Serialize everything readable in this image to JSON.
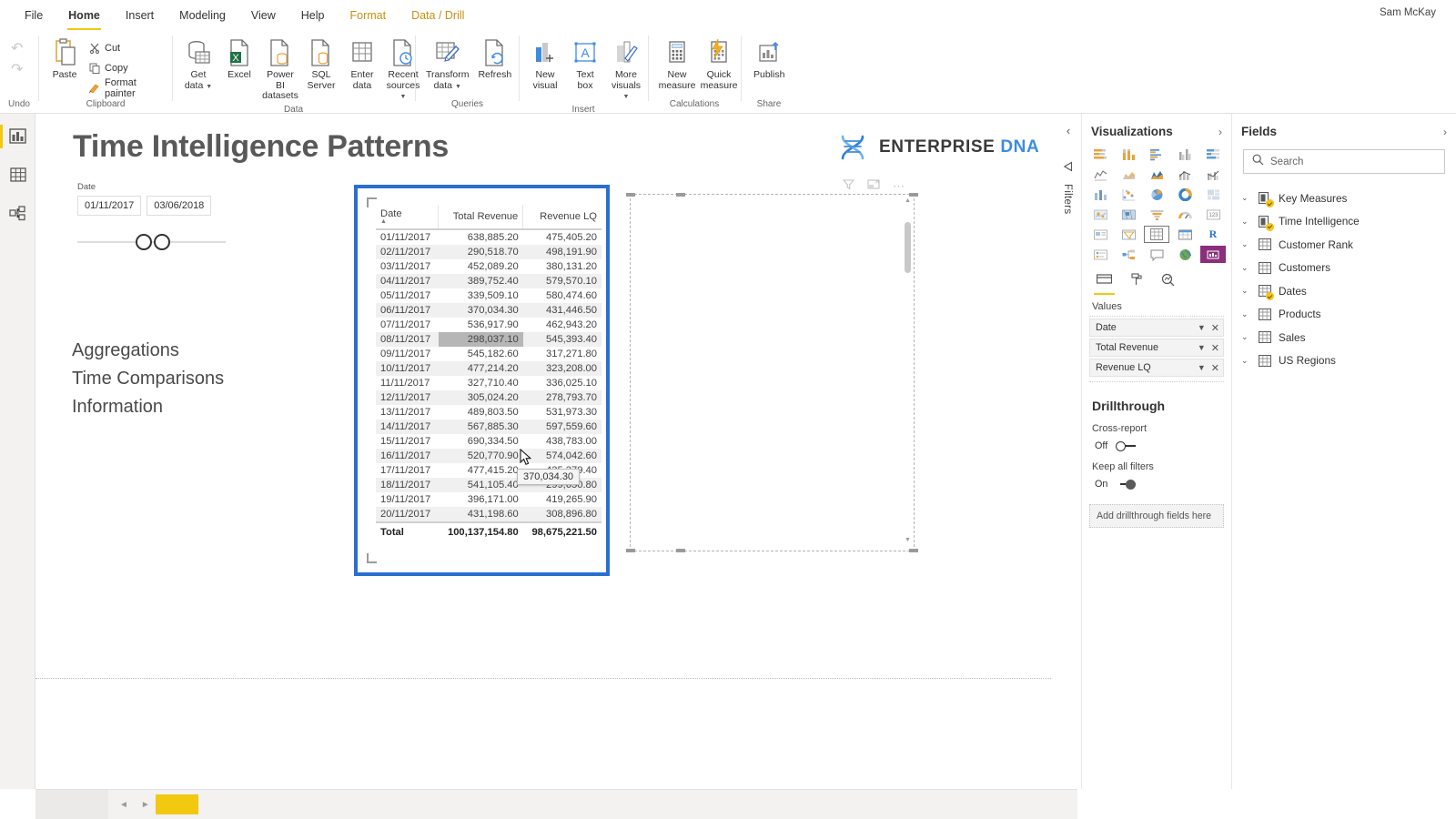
{
  "window": {
    "user": "Sam McKay"
  },
  "menu": {
    "items": [
      {
        "label": "File",
        "state": "normal"
      },
      {
        "label": "Home",
        "state": "active"
      },
      {
        "label": "Insert",
        "state": "normal"
      },
      {
        "label": "Modeling",
        "state": "normal"
      },
      {
        "label": "View",
        "state": "normal"
      },
      {
        "label": "Help",
        "state": "normal"
      },
      {
        "label": "Format",
        "state": "amber"
      },
      {
        "label": "Data / Drill",
        "state": "amber"
      }
    ]
  },
  "ribbon": {
    "groups": [
      {
        "label": "Undo"
      },
      {
        "label": "Clipboard"
      },
      {
        "label": "Data"
      },
      {
        "label": "Queries"
      },
      {
        "label": "Insert"
      },
      {
        "label": "Calculations"
      },
      {
        "label": "Share"
      }
    ],
    "clipboard": {
      "paste": "Paste",
      "cut": "Cut",
      "copy": "Copy",
      "format_painter": "Format painter"
    },
    "data": {
      "get_data_l1": "Get",
      "get_data_l2": "data",
      "excel_l1": "Excel",
      "excel_l2": "",
      "powerbi_l1": "Power BI",
      "powerbi_l2": "datasets",
      "sql_l1": "SQL",
      "sql_l2": "Server",
      "enter_l1": "Enter",
      "enter_l2": "data",
      "recent_l1": "Recent",
      "recent_l2": "sources"
    },
    "queries": {
      "transform_l1": "Transform",
      "transform_l2": "data",
      "refresh_l1": "Refresh",
      "refresh_l2": ""
    },
    "insert": {
      "new_visual_l1": "New",
      "new_visual_l2": "visual",
      "text_box_l1": "Text",
      "text_box_l2": "box",
      "more_visuals_l1": "More",
      "more_visuals_l2": "visuals"
    },
    "calculations": {
      "new_measure_l1": "New",
      "new_measure_l2": "measure",
      "quick_measure_l1": "Quick",
      "quick_measure_l2": "measure"
    },
    "share": {
      "publish_l1": "Publish",
      "publish_l2": ""
    }
  },
  "left_rail": {
    "items": [
      {
        "name": "report-view",
        "selected": true
      },
      {
        "name": "data-view",
        "selected": false
      },
      {
        "name": "model-view",
        "selected": false
      }
    ]
  },
  "report": {
    "title": "Time Intelligence Patterns",
    "logo": {
      "primary": "ENTERPRISE",
      "secondary": "DNA"
    },
    "slicer": {
      "label": "Date",
      "start": "01/11/2017",
      "end": "03/06/2018"
    },
    "text_block": {
      "line1": "Aggregations",
      "line2": "Time Comparisons",
      "line3": "Information"
    }
  },
  "table_visual": {
    "columns": [
      "Date",
      "Total Revenue",
      "Revenue LQ"
    ],
    "sort_column": "Date",
    "sort_direction": "asc",
    "rows": [
      [
        "01/11/2017",
        "638,885.20",
        "475,405.20"
      ],
      [
        "02/11/2017",
        "290,518.70",
        "498,191.90"
      ],
      [
        "03/11/2017",
        "452,089.20",
        "380,131.20"
      ],
      [
        "04/11/2017",
        "389,752.40",
        "579,570.10"
      ],
      [
        "05/11/2017",
        "339,509.10",
        "580,474.60"
      ],
      [
        "06/11/2017",
        "370,034.30",
        "431,446.50"
      ],
      [
        "07/11/2017",
        "536,917.90",
        "462,943.20"
      ],
      [
        "08/11/2017",
        "298,037.10",
        "545,393.40"
      ],
      [
        "09/11/2017",
        "545,182.60",
        "317,271.80"
      ],
      [
        "10/11/2017",
        "477,214.20",
        "323,208.00"
      ],
      [
        "11/11/2017",
        "327,710.40",
        "336,025.10"
      ],
      [
        "12/11/2017",
        "305,024.20",
        "278,793.70"
      ],
      [
        "13/11/2017",
        "489,803.50",
        "531,973.30"
      ],
      [
        "14/11/2017",
        "567,885.30",
        "597,559.60"
      ],
      [
        "15/11/2017",
        "690,334.50",
        "438,783.00"
      ],
      [
        "16/11/2017",
        "520,770.90",
        "574,042.60"
      ],
      [
        "17/11/2017",
        "477,415.20",
        "435,379.40"
      ],
      [
        "18/11/2017",
        "541,105.40",
        "299,650.80"
      ],
      [
        "19/11/2017",
        "396,171.00",
        "419,265.90"
      ],
      [
        "20/11/2017",
        "431,198.60",
        "308,896.80"
      ]
    ],
    "total_row": [
      "Total",
      "100,137,154.80",
      "98,675,221.50"
    ],
    "hovered_cell": {
      "row_index": 7,
      "column_index": 1
    },
    "tooltip": "370,034.30",
    "selection_color": "#2a6fd0"
  },
  "visualizations_pane": {
    "title": "Visualizations",
    "filters_label": "Filters",
    "selected_visual": "table",
    "format_tabs": [
      "fields-tab",
      "format-tab",
      "analytics-tab"
    ],
    "values_label": "Values",
    "wells": [
      {
        "name": "Date"
      },
      {
        "name": "Total Revenue"
      },
      {
        "name": "Revenue LQ"
      }
    ],
    "drillthrough": {
      "title": "Drillthrough",
      "cross_report_label": "Cross-report",
      "cross_report_value": "Off",
      "keep_filters_label": "Keep all filters",
      "keep_filters_value": "On",
      "drop_zone": "Add drillthrough fields here"
    }
  },
  "fields_pane": {
    "title": "Fields",
    "search_placeholder": "Search",
    "items": [
      {
        "label": "Key Measures",
        "type": "measure-table",
        "badge": true
      },
      {
        "label": "Time Intelligence",
        "type": "measure-table",
        "badge": true
      },
      {
        "label": "Customer Rank",
        "type": "table",
        "badge": false
      },
      {
        "label": "Customers",
        "type": "table",
        "badge": false
      },
      {
        "label": "Dates",
        "type": "table",
        "badge": true
      },
      {
        "label": "Products",
        "type": "table",
        "badge": false
      },
      {
        "label": "Sales",
        "type": "table",
        "badge": false
      },
      {
        "label": "US Regions",
        "type": "table",
        "badge": false
      }
    ]
  },
  "colors": {
    "accent_yellow": "#f2c811",
    "selection_blue": "#2a6fd0",
    "logo_blue": "#3d8ce0"
  }
}
